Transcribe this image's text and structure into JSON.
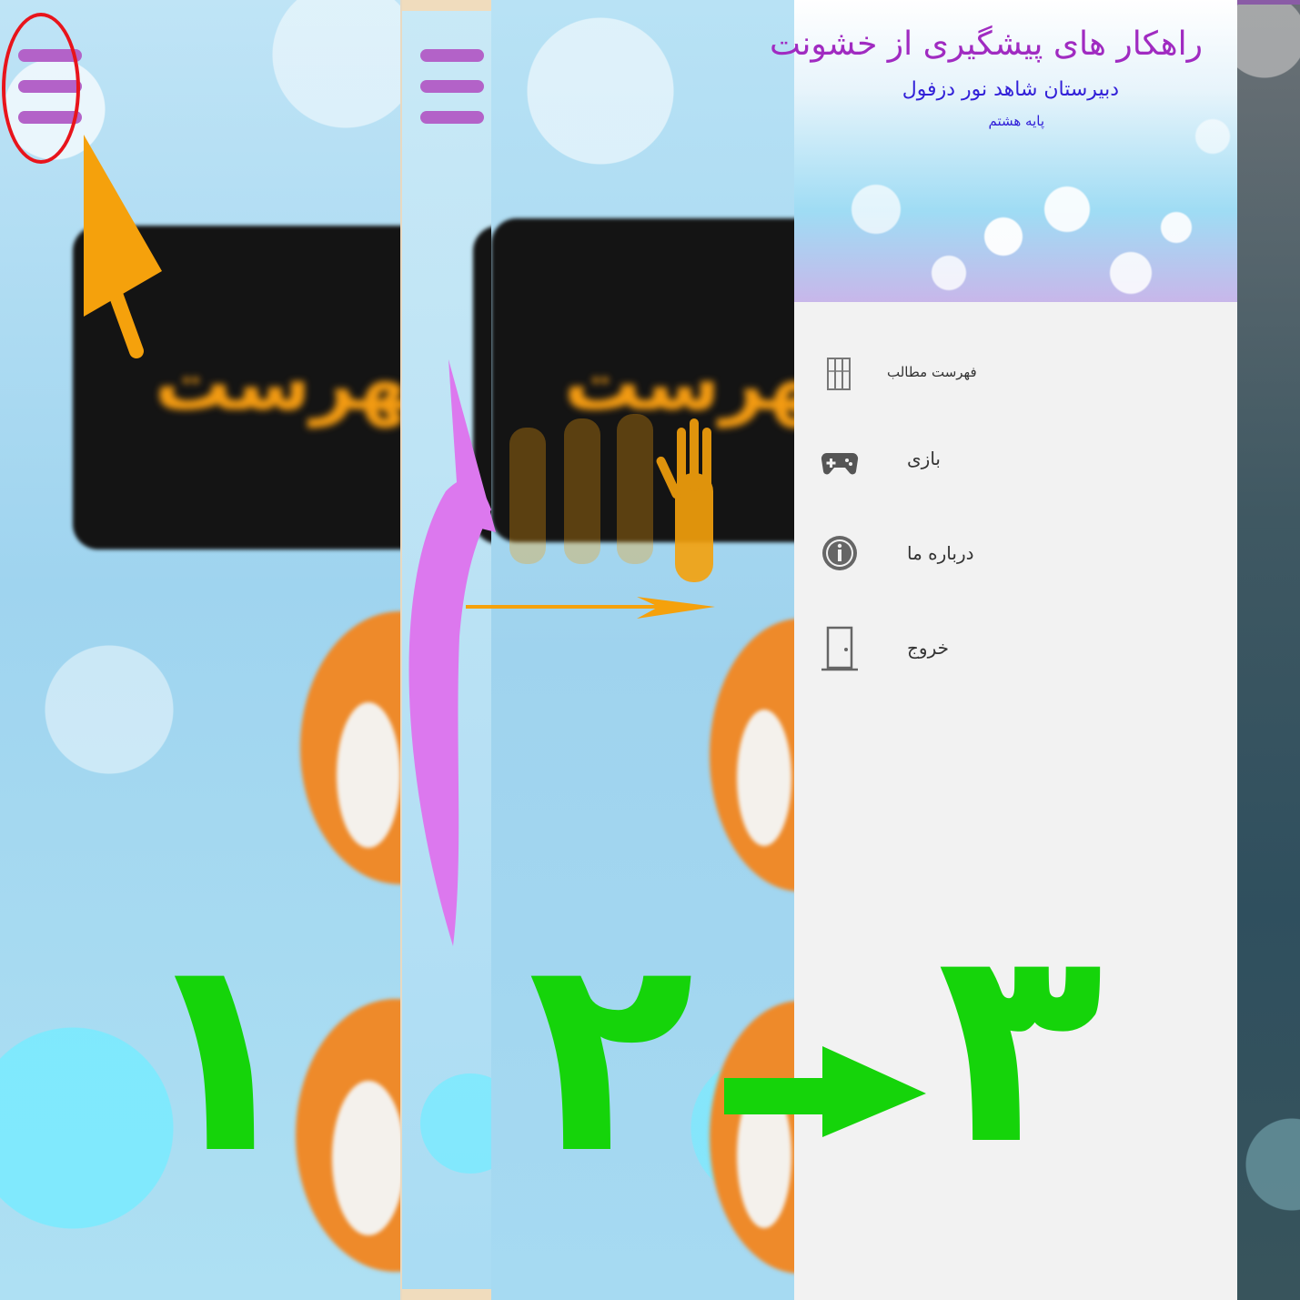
{
  "drawer": {
    "title": "راهکار های پیشگیری از خشونت",
    "subtitle": "دبیرستان شاهد نور دزفول",
    "grade": "پایه هشتم",
    "items": [
      {
        "label": "فهرست مطالب",
        "icon": "book-icon"
      },
      {
        "label": "بازی",
        "icon": "gamepad-icon"
      },
      {
        "label": "درباره ما",
        "icon": "info-icon"
      },
      {
        "label": "خروج",
        "icon": "exit-door-icon"
      }
    ]
  },
  "background_card": {
    "text": "فهرست"
  },
  "steps": {
    "one": "۱",
    "two": "۲",
    "three": "۳"
  },
  "colors": {
    "accent_purple": "#b362c8",
    "step_green": "#15d40a",
    "arrow_orange": "#f5a10c",
    "drawer_title": "#a02bc1",
    "drawer_subtitle": "#3220d8"
  }
}
